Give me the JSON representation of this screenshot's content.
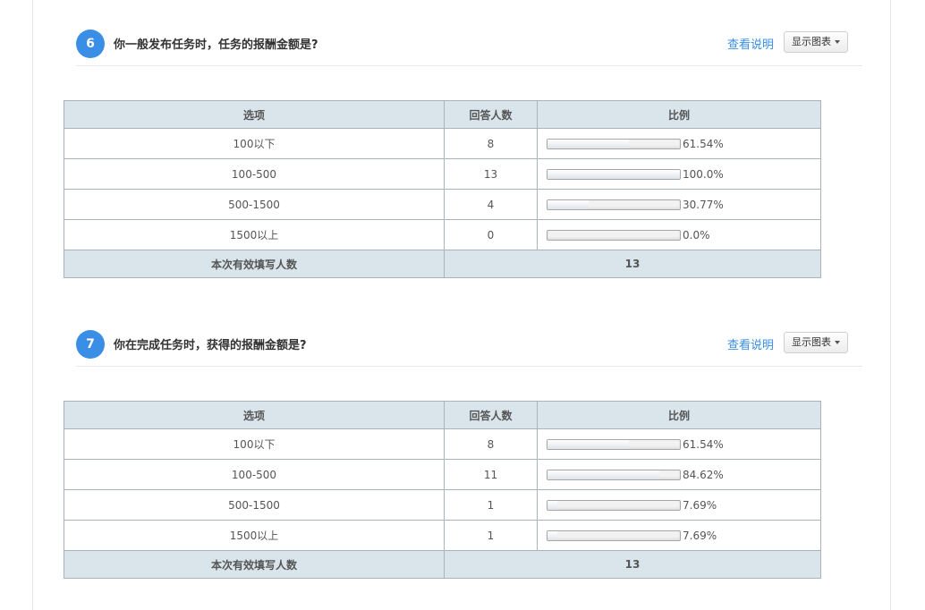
{
  "questions": [
    {
      "number": "6",
      "title": "你一般发布任务时，任务的报酬金额是?",
      "link": "查看说明",
      "button": "显示图表",
      "headers": [
        "选项",
        "回答人数",
        "比例"
      ],
      "rows": [
        {
          "option": "100以下",
          "count": "8",
          "percent": "61.54%",
          "ratio": 0.6154
        },
        {
          "option": "100-500",
          "count": "13",
          "percent": "100.0%",
          "ratio": 1.0
        },
        {
          "option": "500-1500",
          "count": "4",
          "percent": "30.77%",
          "ratio": 0.3077
        },
        {
          "option": "1500以上",
          "count": "0",
          "percent": "0.0%",
          "ratio": 0.0
        }
      ],
      "total_label": "本次有效填写人数",
      "total_value": "13"
    },
    {
      "number": "7",
      "title": "你在完成任务时，获得的报酬金额是?",
      "link": "查看说明",
      "button": "显示图表",
      "headers": [
        "选项",
        "回答人数",
        "比例"
      ],
      "rows": [
        {
          "option": "100以下",
          "count": "8",
          "percent": "61.54%",
          "ratio": 0.6154
        },
        {
          "option": "100-500",
          "count": "11",
          "percent": "84.62%",
          "ratio": 0.8462
        },
        {
          "option": "500-1500",
          "count": "1",
          "percent": "7.69%",
          "ratio": 0.0769
        },
        {
          "option": "1500以上",
          "count": "1",
          "percent": "7.69%",
          "ratio": 0.0769
        }
      ],
      "total_label": "本次有效填写人数",
      "total_value": "13"
    }
  ],
  "colors": {
    "accent": "#3a8ee6",
    "header_bg": "#d9e4eb",
    "border": "#a9b3ba"
  }
}
